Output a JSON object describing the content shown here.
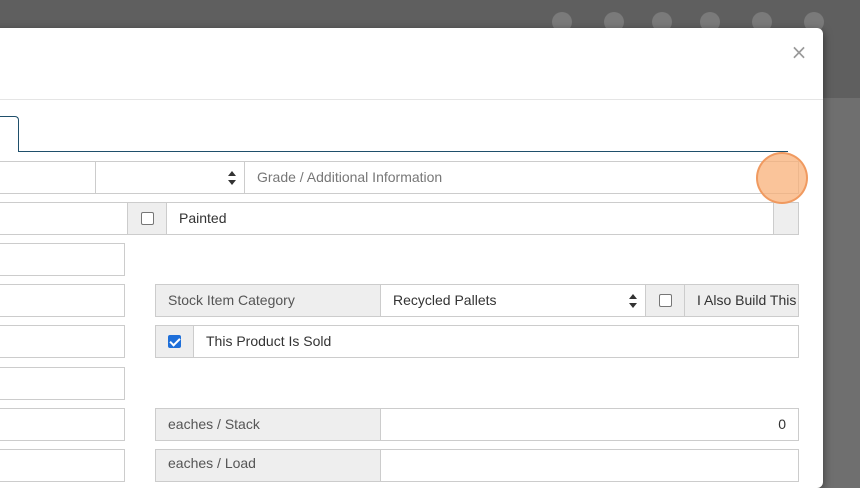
{
  "modal": {
    "close_label": "×"
  },
  "row1": {
    "grade_placeholder": "Grade / Additional Information",
    "select_value": ""
  },
  "row2": {
    "painted_label": "Painted"
  },
  "row4": {
    "stock_category_label": "Stock Item Category",
    "stock_category_value": "Recycled Pallets",
    "also_build_label": "I Also Build This"
  },
  "row5": {
    "sold_label": "This Product Is Sold"
  },
  "row7": {
    "per_stack_label": "eaches / Stack",
    "per_stack_value": "0"
  },
  "row8": {
    "per_load_label": "eaches / Load"
  },
  "colors": {
    "accent": "#1f4f6b",
    "checkbox_checked": "#1e6fd9",
    "addon_bg": "#eeeeee"
  }
}
